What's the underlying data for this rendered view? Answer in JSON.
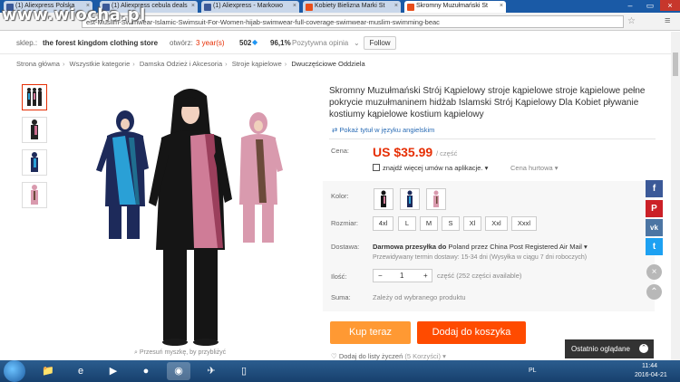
{
  "browser": {
    "tabs": [
      {
        "label": "(1) Aliexpress Polska",
        "favicon": "facebook-icon"
      },
      {
        "label": "(1) Aliexpress cebula deals",
        "favicon": "facebook-icon"
      },
      {
        "label": "(1) Aliexpress - Markowo",
        "favicon": "facebook-icon"
      },
      {
        "label": "Kobiety Bielizna Marki St",
        "favicon": "aliexpress-icon"
      },
      {
        "label": "Skromny Muzułmański St",
        "favicon": "aliexpress-icon"
      }
    ],
    "url": "est-Muslim-Swimwear-Islamic-Swimsuit-For-Women-hijab-swimwear-full-coverage-swimwear-muslim-swimming-beac",
    "watermark": "www.wiocha.pl"
  },
  "store": {
    "label": "sklep.:",
    "name": "the forest kingdom clothing store",
    "opened_label": "otwórz:",
    "opened_value": "3 year(s)",
    "rating_count": "502",
    "positive_percent": "96,1%",
    "positive_label": "Pozytywna opinia",
    "follow": "Follow"
  },
  "breadcrumb": [
    "Strona główna",
    "Wszystkie kategorie",
    "Damska Odzież i Akcesoria",
    "Stroje kąpielowe",
    "Dwuczęściowe Oddziela"
  ],
  "gallery": {
    "zoom_hint": "Przesuń myszkę, by przybliżyć"
  },
  "product": {
    "title": "Skromny Muzułmański Strój Kąpielowy stroje kąpielowe stroje kąpielowe pełne pokrycie muzułmaninem hidżab Islamski Strój Kąpielowy Dla Kobiet pływanie kostiumy kąpielowe kostium kąpielowy",
    "translate_link": "Pokaż tytuł w języku angielskim",
    "price_label": "Cena:",
    "price": "US $35.99",
    "price_unit": "/ część",
    "app_deal": "znajdź więcej umów na aplikacje.",
    "wholesale": "Cena hurtowa",
    "color_label": "Kolor:",
    "size_label": "Rozmiar:",
    "sizes": [
      "4xl",
      "L",
      "M",
      "S",
      "Xl",
      "Xxl",
      "Xxxl"
    ],
    "shipping_label": "Dostawa:",
    "shipping_free": "Darmowa przesyłka do",
    "shipping_dest": "Poland przez China Post Registered Air Mail",
    "shipping_eta": "Przewidywany termin dostawy: 15-34 dni (Wysyłka w ciągu 7 dni roboczych)",
    "qty_label": "Ilość:",
    "qty_value": "1",
    "qty_note": "część (252 części available)",
    "total_label": "Suma:",
    "total_note": "Zależy od wybranego produktu",
    "buy_now": "Kup teraz",
    "add_cart": "Dodaj do koszyka",
    "wishlist": "Dodaj do listy życzeń",
    "wishlist_count": "(5 Korzyści)",
    "recently_viewed": "Ostatnio oglądane"
  },
  "social": [
    "f",
    "P",
    "vk",
    "t"
  ],
  "taskbar": {
    "lang": "PL",
    "time": "11:44",
    "date": "2016-04-21"
  },
  "colors": {
    "accent": "#e62e04",
    "buy": "#ff9933",
    "cart": "#ff4b00",
    "facebook": "#3b5998",
    "pinterest": "#cb2027",
    "vk": "#4c75a3",
    "twitter": "#1da1f2"
  }
}
